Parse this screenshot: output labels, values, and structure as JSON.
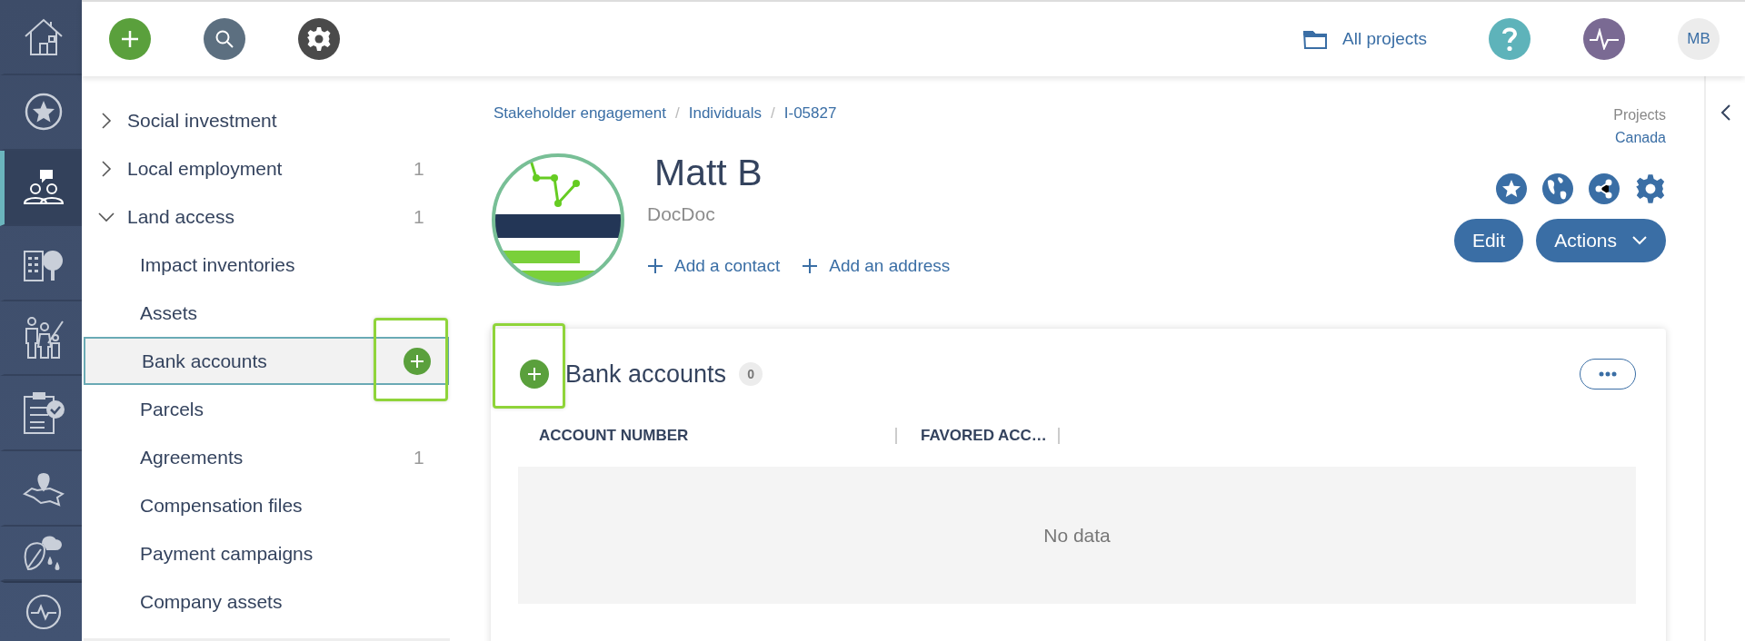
{
  "rail": {
    "items": [
      {
        "kind": "home",
        "selected": false
      },
      {
        "kind": "star",
        "selected": false
      },
      {
        "kind": "people",
        "selected": true
      },
      {
        "kind": "building",
        "selected": false
      },
      {
        "kind": "family",
        "selected": false
      },
      {
        "kind": "clipboard",
        "selected": false
      },
      {
        "kind": "map",
        "selected": false
      },
      {
        "kind": "leaf",
        "selected": false
      },
      {
        "kind": "pulse",
        "selected": false
      }
    ]
  },
  "topbar": {
    "projects_link": "All projects",
    "user_initials": "MB"
  },
  "sidebar": {
    "items": [
      {
        "label": "Social investment",
        "expanded": false
      },
      {
        "label": "Local employment",
        "expanded": false,
        "count": "1"
      },
      {
        "label": "Land access",
        "expanded": true,
        "count": "1",
        "children": [
          {
            "label": "Impact inventories",
            "selected": false
          },
          {
            "label": "Assets",
            "selected": false
          },
          {
            "label": "Bank accounts",
            "selected": true
          },
          {
            "label": "Parcels",
            "selected": false
          },
          {
            "label": "Agreements",
            "selected": false,
            "count": "1"
          },
          {
            "label": "Compensation files",
            "selected": false
          },
          {
            "label": "Payment campaigns",
            "selected": false
          },
          {
            "label": "Company assets",
            "selected": false
          }
        ]
      }
    ]
  },
  "breadcrumb": {
    "separator": "/",
    "items": [
      "Stakeholder engagement",
      "Individuals",
      "I-05827"
    ]
  },
  "record": {
    "name": "Matt B",
    "subtitle": "DocDoc",
    "links": [
      "Add a contact",
      "Add an address"
    ],
    "project_label": "Projects",
    "project_value": "Canada",
    "buttons": [
      {
        "label": "Edit",
        "kind": "plain"
      },
      {
        "label": "Actions",
        "kind": "dropdown"
      }
    ]
  },
  "card": {
    "title": "Bank accounts",
    "count": "0",
    "columns": [
      "ACCOUNT NUMBER",
      "FAVORED ACC…"
    ],
    "empty_text": "No data"
  }
}
